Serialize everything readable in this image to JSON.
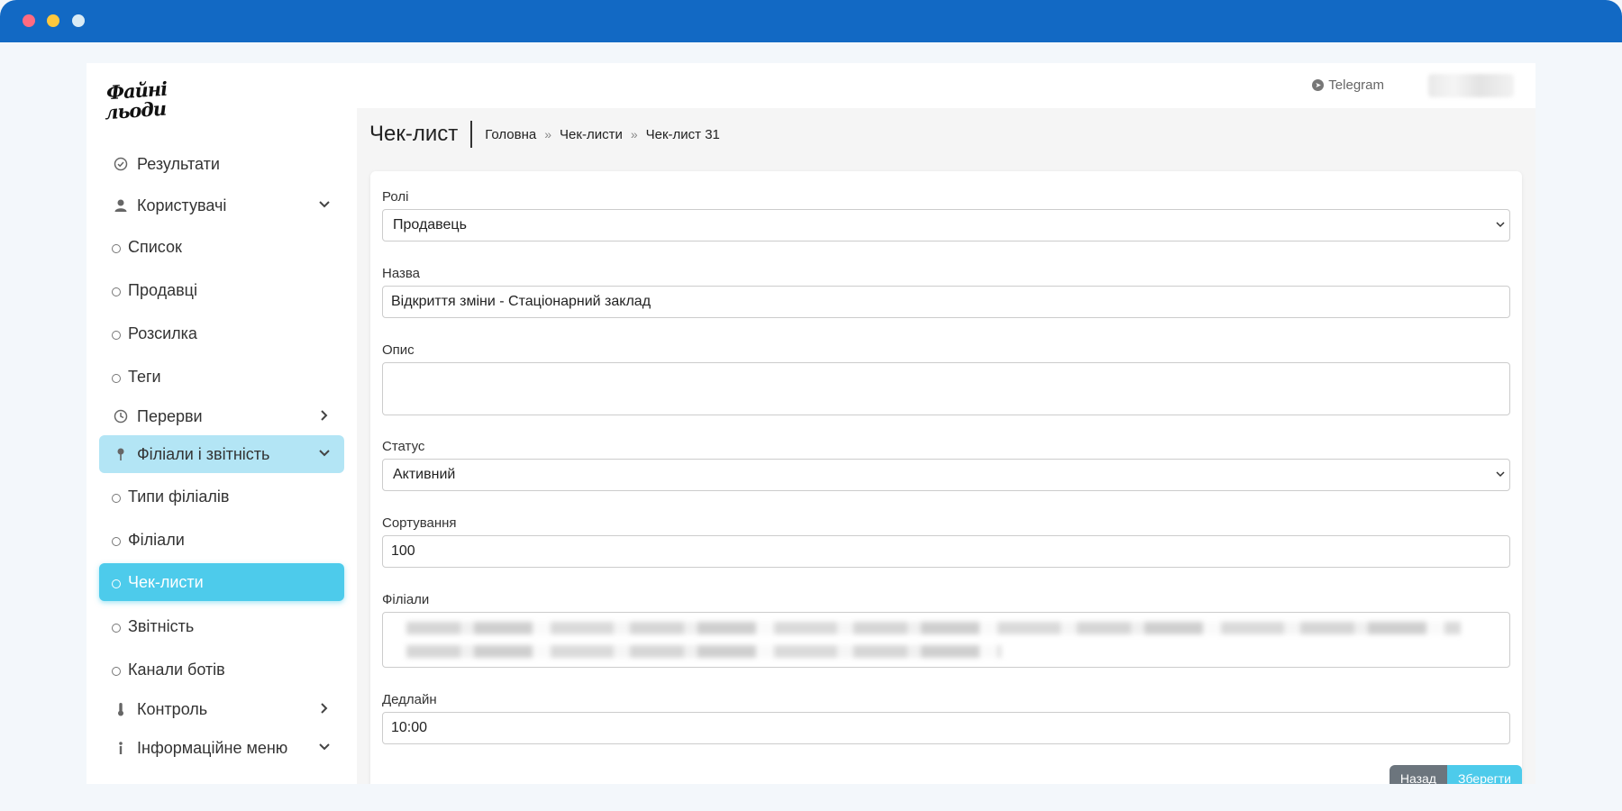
{
  "sidebar": {
    "logo": {
      "line1": "Файні",
      "line2": "льоди"
    },
    "items": [
      {
        "label": "Результати"
      },
      {
        "label": "Користувачі"
      },
      {
        "label": "Список"
      },
      {
        "label": "Продавці"
      },
      {
        "label": "Розсилка"
      },
      {
        "label": "Теги"
      },
      {
        "label": "Перерви"
      },
      {
        "label": "Філіали і звітність"
      },
      {
        "label": "Типи філіалів"
      },
      {
        "label": "Філіали"
      },
      {
        "label": "Чек-листи"
      },
      {
        "label": "Звітність"
      },
      {
        "label": "Канали ботів"
      },
      {
        "label": "Контроль"
      },
      {
        "label": "Інформаційне меню"
      }
    ],
    "active_group_color": "#b3e5f5",
    "active_item_color": "#4dcbeb"
  },
  "topbar": {
    "telegram_label": "Telegram"
  },
  "page": {
    "title": "Чек-лист",
    "breadcrumb": [
      "Головна",
      "Чек-листи",
      "Чек-лист 31"
    ],
    "breadcrumb_sep": "»"
  },
  "form": {
    "roles": {
      "label": "Ролі",
      "value": "Продавець"
    },
    "name": {
      "label": "Назва",
      "value": "Відкриття зміни - Стаціонарний заклад"
    },
    "description": {
      "label": "Опис",
      "value": ""
    },
    "status": {
      "label": "Статус",
      "value": "Активний"
    },
    "sorting": {
      "label": "Сортування",
      "value": "100"
    },
    "branches": {
      "label": "Філіали"
    },
    "deadline": {
      "label": "Дедлайн",
      "value": "10:00"
    },
    "back_button": "Назад",
    "save_button": "Зберегти"
  },
  "colors": {
    "titlebar": "#1269c4",
    "accent": "#4dcbeb"
  }
}
